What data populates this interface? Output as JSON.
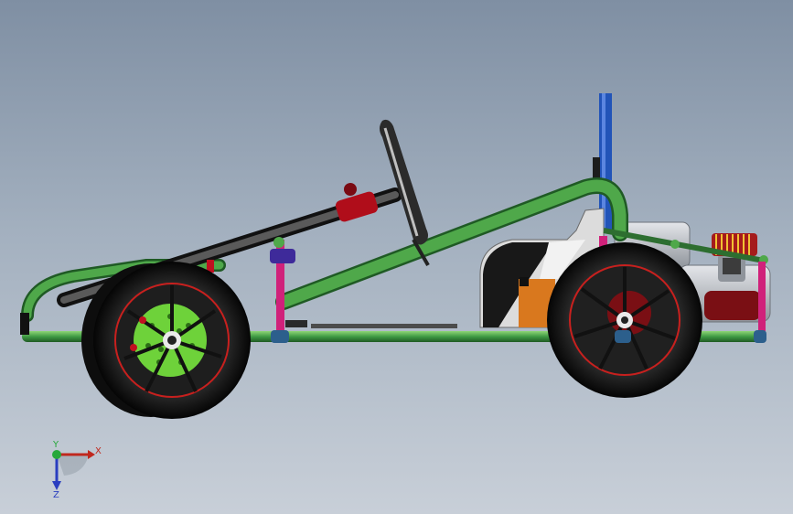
{
  "window": {
    "title": ""
  },
  "viewport": {
    "background_top": "#7f8fa3",
    "background_bottom": "#c8cfd8",
    "model": "go-kart-assembly-side-view"
  },
  "colors": {
    "frame_green": "#3f9a44",
    "frame_green_light": "#79c465",
    "steering_dark": "#2e2e2e",
    "steering_red": "#b00d1a",
    "pink_strut": "#d0217a",
    "brake_disc": "#6ed23a",
    "seat_blue": "#2254b8",
    "engine_grey": "#c6c8cc",
    "orange_block": "#d9781e",
    "tire": "#1a1a1a",
    "rim": "#2a2a2a",
    "rim_stripe": "#c8201e"
  },
  "triad": {
    "x_label": "X",
    "y_label": "Y",
    "z_label": "Z",
    "x_color": "#c0281e",
    "y_color": "#26a83a",
    "z_color": "#2a3ec0"
  }
}
